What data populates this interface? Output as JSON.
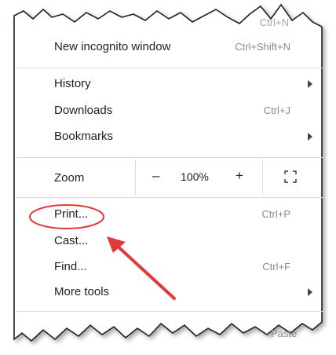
{
  "top_partial_shortcut": "Ctrl+N",
  "menu": {
    "new_incognito": {
      "label": "New incognito window",
      "shortcut": "Ctrl+Shift+N"
    },
    "history": {
      "label": "History"
    },
    "downloads": {
      "label": "Downloads",
      "shortcut": "Ctrl+J"
    },
    "bookmarks": {
      "label": "Bookmarks"
    },
    "zoom": {
      "label": "Zoom",
      "minus": "–",
      "value": "100%",
      "plus": "+"
    },
    "print": {
      "label": "Print...",
      "shortcut": "Ctrl+P"
    },
    "cast": {
      "label": "Cast..."
    },
    "find": {
      "label": "Find...",
      "shortcut": "Ctrl+F"
    },
    "more_tools": {
      "label": "More tools"
    }
  },
  "bottom_partial_text": "Paste",
  "annotation_colors": {
    "highlight": "#e03a3a"
  },
  "icons": {
    "submenu": "chevron-right-icon",
    "fullscreen": "fullscreen-icon"
  }
}
